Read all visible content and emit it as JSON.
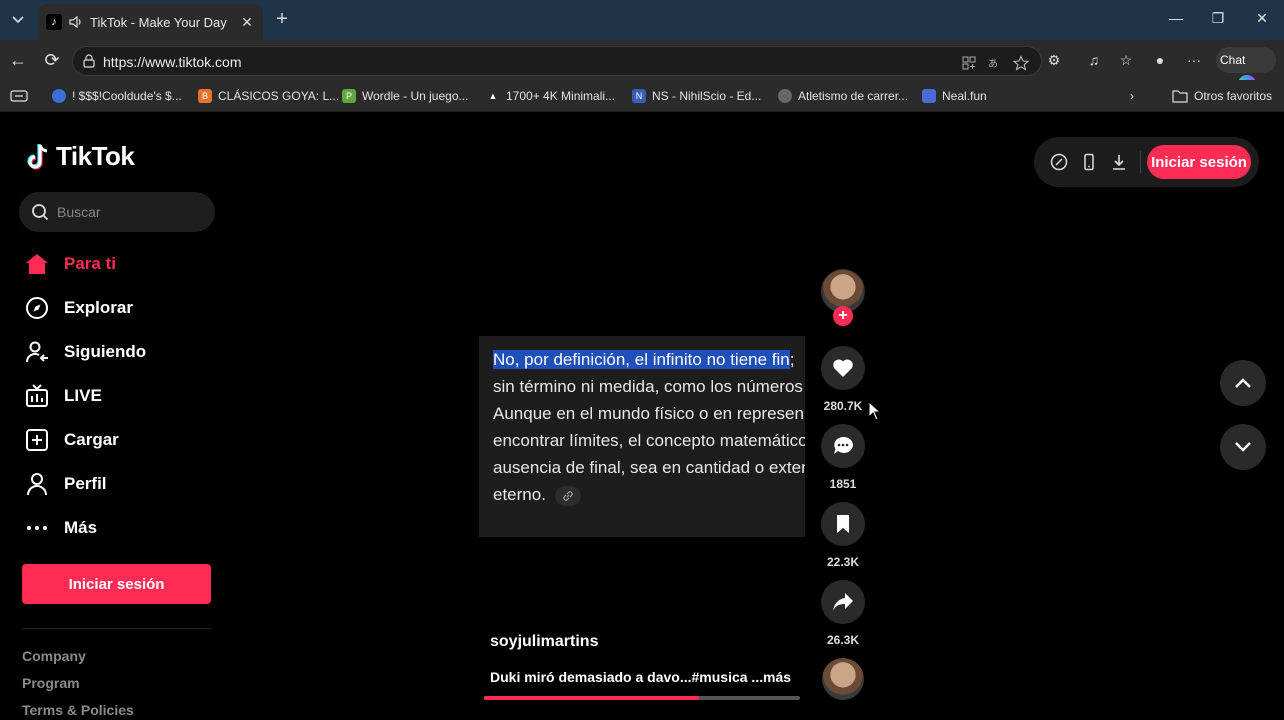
{
  "browser": {
    "tab_title": "TikTok - Make Your Day",
    "url": "https://www.tiktok.com",
    "copilot_label": "Chat",
    "bookmarks": [
      {
        "label": "! $$$!Cooldude's $...",
        "color": "#3b6fd8"
      },
      {
        "label": "CLÁSICOS GOYA: L...",
        "color": "#e8732a"
      },
      {
        "label": "Wordle - Un juego...",
        "color": "#5fa83a"
      },
      {
        "label": "1700+ 4K Minimali...",
        "color": "#555555"
      },
      {
        "label": "NS - NihilScio - Ed...",
        "color": "#3b5fb8"
      },
      {
        "label": "Atletismo de carrer...",
        "color": "#666666"
      },
      {
        "label": "Neal.fun",
        "color": "#4a6bd8"
      }
    ],
    "other_favorites": "Otros favoritos"
  },
  "sidebar": {
    "logo_text": "TikTok",
    "search_placeholder": "Buscar",
    "nav": [
      {
        "label": "Para ti",
        "icon": "home-icon",
        "active": true
      },
      {
        "label": "Explorar",
        "icon": "compass-icon",
        "active": false
      },
      {
        "label": "Siguiendo",
        "icon": "following-icon",
        "active": false
      },
      {
        "label": "LIVE",
        "icon": "live-icon",
        "active": false
      },
      {
        "label": "Cargar",
        "icon": "upload-icon",
        "active": false
      },
      {
        "label": "Perfil",
        "icon": "profile-icon",
        "active": false
      },
      {
        "label": "Más",
        "icon": "more-icon",
        "active": false
      }
    ],
    "login_label": "Iniciar sesión",
    "footer_links": [
      "Company",
      "Program",
      "Terms & Policies"
    ]
  },
  "header": {
    "login_label": "Iniciar sesión"
  },
  "video": {
    "text_highlight": "No, por definición, el infinito no tiene fin",
    "text_line1_rest": ";",
    "lines": [
      "sin término ni medida, como los números",
      "Aunque en el mundo físico o en represen",
      "encontrar límites, el concepto matemático",
      "ausencia de final, sea en cantidad o exten"
    ],
    "last_line": "eterno.",
    "author": "soyjulimartins",
    "caption": "Duki miró demasiado a davo...#musica ...",
    "more_label": "más",
    "progress": 0.68
  },
  "actions": {
    "likes": "280.7K",
    "comments": "1851",
    "saves": "22.3K",
    "shares": "26.3K"
  },
  "colors": {
    "accent": "#fe2c55",
    "highlight": "#1f4fb8"
  }
}
